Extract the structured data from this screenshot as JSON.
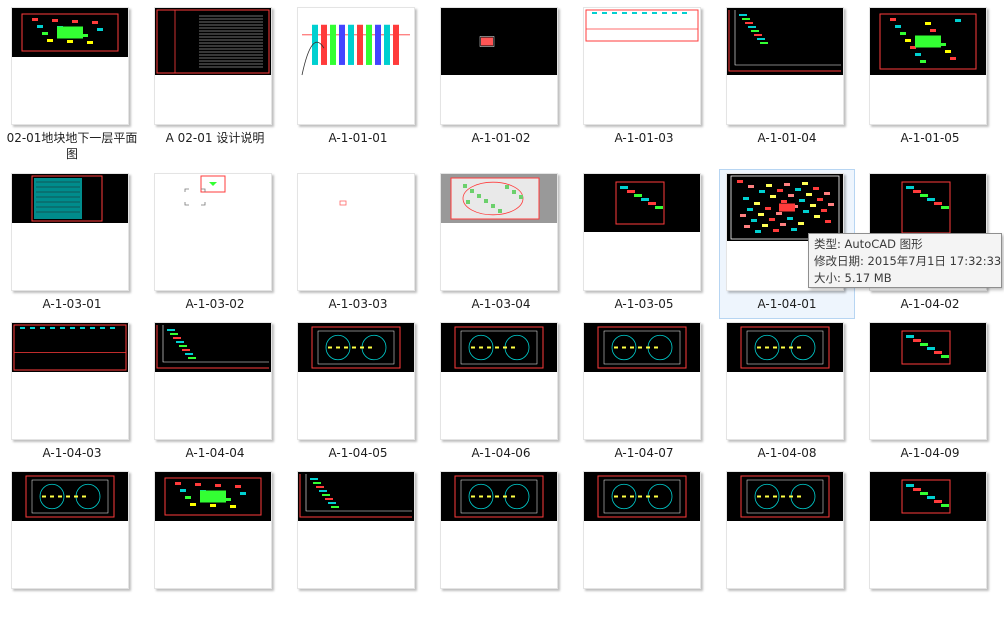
{
  "items": [
    {
      "name": "02-01地块地下一层平面图",
      "bg": "#000000",
      "fill": 0.42,
      "style": "colorful-plan"
    },
    {
      "name": "A 02-01 设计说明",
      "bg": "#000000",
      "fill": 0.58,
      "style": "text-sheet"
    },
    {
      "name": "A-1-01-01",
      "bg": "#ffffff",
      "fill": 0.58,
      "style": "elevation"
    },
    {
      "name": "A-1-01-02",
      "bg": "#000000",
      "fill": 0.58,
      "style": "tiny-center"
    },
    {
      "name": "A-1-01-03",
      "bg": "#ffffff",
      "fill": 0.3,
      "style": "border-top"
    },
    {
      "name": "A-1-01-04",
      "bg": "#000000",
      "fill": 0.58,
      "style": "border-corner"
    },
    {
      "name": "A-1-01-05",
      "bg": "#000000",
      "fill": 0.58,
      "style": "colorful-plan"
    },
    {
      "name": "A-1-03-01",
      "bg": "#000000",
      "fill": 0.42,
      "style": "teal-plan"
    },
    {
      "name": "A-1-03-02",
      "bg": "#ffffff",
      "fill": 0.0,
      "style": "tiny-white"
    },
    {
      "name": "A-1-03-03",
      "bg": "#ffffff",
      "fill": 0.0,
      "style": "dot-center"
    },
    {
      "name": "A-1-03-04",
      "bg": "#999999",
      "fill": 0.42,
      "style": "site-plan"
    },
    {
      "name": "A-1-03-05",
      "bg": "#000000",
      "fill": 0.5,
      "style": "small-sheet"
    },
    {
      "name": "A-1-04-01",
      "bg": "#000000",
      "fill": 0.58,
      "style": "red-plan"
    },
    {
      "name": "A-1-04-02",
      "bg": "#000000",
      "fill": 0.58,
      "style": "small-sheet"
    },
    {
      "name": "A-1-04-03",
      "bg": "#000000",
      "fill": 0.42,
      "style": "border-top"
    },
    {
      "name": "A-1-04-04",
      "bg": "#000000",
      "fill": 0.42,
      "style": "border-corner"
    },
    {
      "name": "A-1-04-05",
      "bg": "#000000",
      "fill": 0.42,
      "style": "floor-plan"
    },
    {
      "name": "A-1-04-06",
      "bg": "#000000",
      "fill": 0.42,
      "style": "floor-plan"
    },
    {
      "name": "A-1-04-07",
      "bg": "#000000",
      "fill": 0.42,
      "style": "floor-plan"
    },
    {
      "name": "A-1-04-08",
      "bg": "#000000",
      "fill": 0.42,
      "style": "floor-plan"
    },
    {
      "name": "A-1-04-09",
      "bg": "#000000",
      "fill": 0.42,
      "style": "small-sheet"
    },
    {
      "name": "",
      "bg": "#000000",
      "fill": 0.42,
      "style": "floor-plan"
    },
    {
      "name": "",
      "bg": "#000000",
      "fill": 0.42,
      "style": "colorful-plan"
    },
    {
      "name": "",
      "bg": "#000000",
      "fill": 0.42,
      "style": "border-corner"
    },
    {
      "name": "",
      "bg": "#000000",
      "fill": 0.42,
      "style": "floor-plan"
    },
    {
      "name": "",
      "bg": "#000000",
      "fill": 0.42,
      "style": "floor-plan"
    },
    {
      "name": "",
      "bg": "#000000",
      "fill": 0.42,
      "style": "floor-plan"
    },
    {
      "name": "",
      "bg": "#000000",
      "fill": 0.42,
      "style": "small-sheet"
    }
  ],
  "selected_index": 12,
  "tooltip": {
    "type": "类型: AutoCAD 图形",
    "modified": "修改日期: 2015年7月1日 17:32:33",
    "size": "大小: 5.17 MB"
  },
  "colors": {
    "selection_bg": "#eef5fd",
    "selection_border": "#b7d5f2",
    "cad_red": "#ff3b3b",
    "cad_cyan": "#00d0d0",
    "cad_green": "#33ff33"
  }
}
